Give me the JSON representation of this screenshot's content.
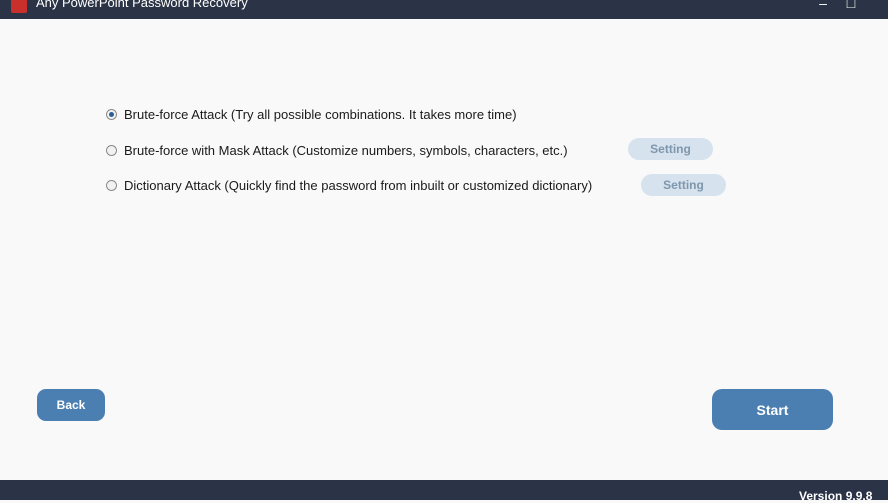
{
  "window": {
    "title": "Any PowerPoint Password Recovery",
    "minimize_glyph": "–",
    "close_glyph": "□"
  },
  "options": [
    {
      "label": "Brute-force Attack (Try all possible combinations. It takes more time)",
      "selected": true
    },
    {
      "label": "Brute-force with Mask Attack (Customize numbers, symbols, characters, etc.)",
      "selected": false,
      "button": "Setting"
    },
    {
      "label": "Dictionary Attack (Quickly find the password from inbuilt or customized dictionary)",
      "selected": false,
      "button": "Setting"
    }
  ],
  "buttons": {
    "back": "Back",
    "start": "Start"
  },
  "footer": {
    "version": "Version 9.9.8"
  },
  "colors": {
    "titlebar": "#2b3446",
    "accent": "#4b7fb1",
    "setting_bg": "#d6e2ee"
  }
}
